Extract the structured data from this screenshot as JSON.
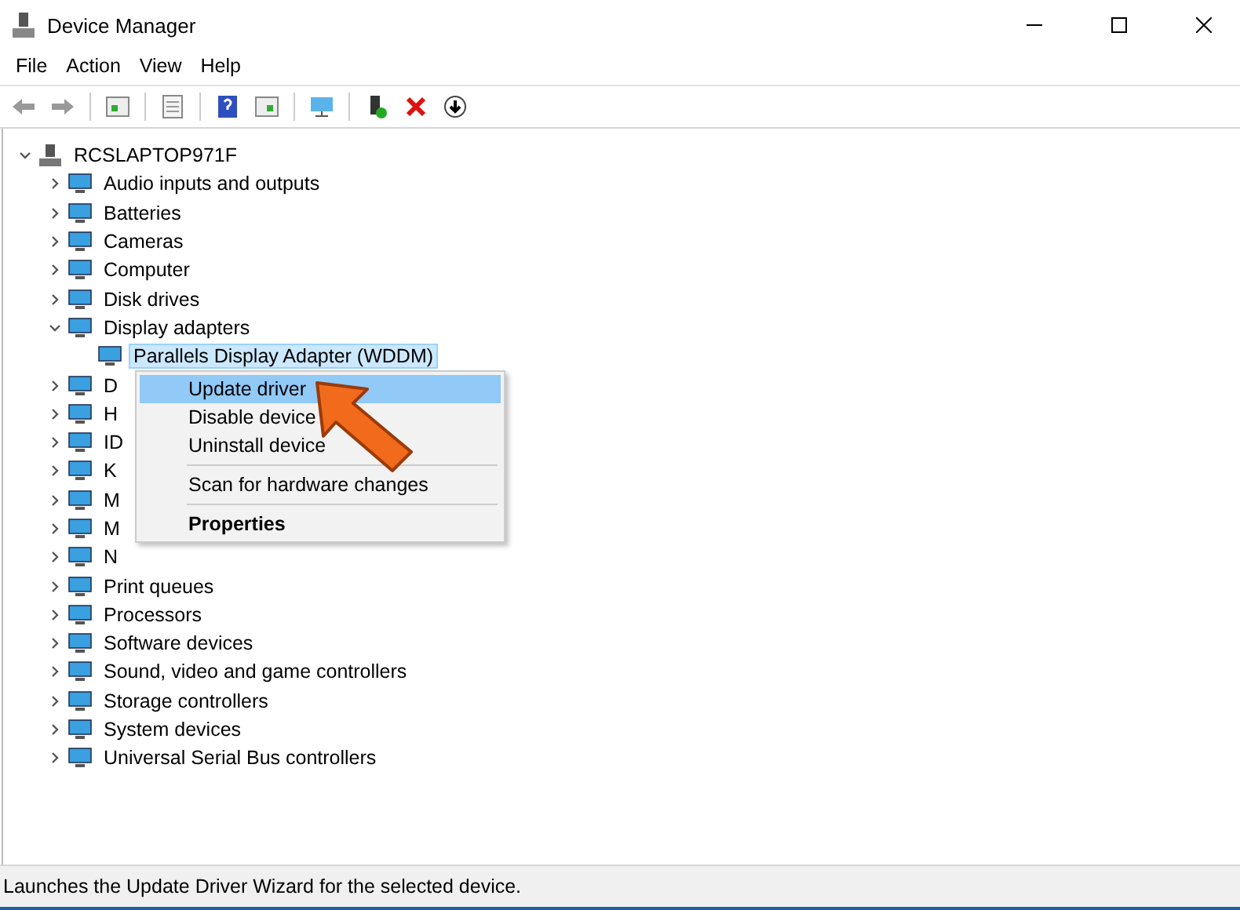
{
  "window": {
    "title": "Device Manager"
  },
  "menu_bar": [
    "File",
    "Action",
    "View",
    "Help"
  ],
  "tree": {
    "label": "RCSLAPTOP971F",
    "expanded": true,
    "selected": false,
    "children": [
      {
        "label": "Audio inputs and outputs",
        "expanded": false,
        "selected": false
      },
      {
        "label": "Batteries",
        "expanded": false,
        "selected": false
      },
      {
        "label": "Cameras",
        "expanded": false,
        "selected": false
      },
      {
        "label": "Computer",
        "expanded": false,
        "selected": false
      },
      {
        "label": "Disk drives",
        "expanded": false,
        "selected": false
      },
      {
        "label": "Display adapters",
        "expanded": true,
        "selected": false,
        "children": [
          {
            "label": "Parallels Display Adapter (WDDM)",
            "selected": true
          }
        ]
      },
      {
        "label": "D",
        "expanded": false,
        "selected": false
      },
      {
        "label": "H",
        "expanded": false,
        "selected": false
      },
      {
        "label": "ID",
        "expanded": false,
        "selected": false
      },
      {
        "label": "K",
        "expanded": false,
        "selected": false
      },
      {
        "label": "M",
        "expanded": false,
        "selected": false
      },
      {
        "label": "M",
        "expanded": false,
        "selected": false
      },
      {
        "label": "N",
        "expanded": false,
        "selected": false
      },
      {
        "label": "Print queues",
        "expanded": false,
        "selected": false
      },
      {
        "label": "Processors",
        "expanded": false,
        "selected": false
      },
      {
        "label": "Software devices",
        "expanded": false,
        "selected": false
      },
      {
        "label": "Sound, video and game controllers",
        "expanded": false,
        "selected": false
      },
      {
        "label": "Storage controllers",
        "expanded": false,
        "selected": false
      },
      {
        "label": "System devices",
        "expanded": false,
        "selected": false
      },
      {
        "label": "Universal Serial Bus controllers",
        "expanded": false,
        "selected": false
      }
    ]
  },
  "context_menu": [
    {
      "kind": "item",
      "label": "Update driver",
      "selected": true,
      "default": false
    },
    {
      "kind": "item",
      "label": "Disable device",
      "selected": false,
      "default": false
    },
    {
      "kind": "item",
      "label": "Uninstall device",
      "selected": false,
      "default": false
    },
    {
      "kind": "separator"
    },
    {
      "kind": "item",
      "label": "Scan for hardware changes",
      "selected": false,
      "default": false
    },
    {
      "kind": "separator"
    },
    {
      "kind": "item",
      "label": "Properties",
      "selected": false,
      "default": true
    }
  ],
  "status_bar": "Launches the Update Driver Wizard for the selected device."
}
